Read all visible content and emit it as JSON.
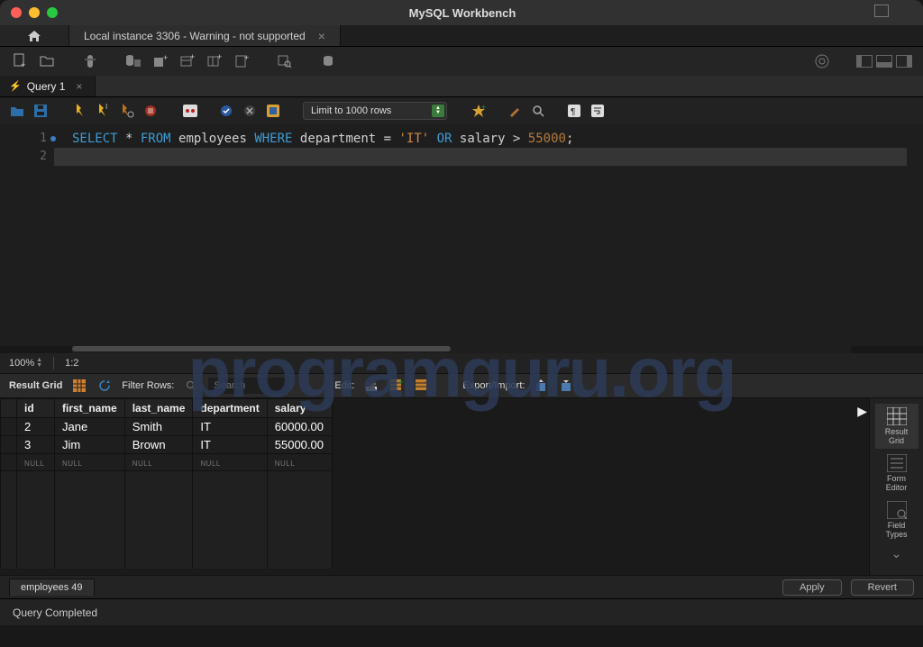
{
  "window": {
    "title": "MySQL Workbench"
  },
  "conn_tab": {
    "label": "Local instance 3306 - Warning - not supported"
  },
  "query_tab": {
    "label": "Query 1"
  },
  "limit_dropdown": {
    "selected": "Limit to 1000 rows"
  },
  "editor": {
    "lines": [
      "1",
      "2"
    ],
    "sql_tokens": [
      {
        "t": "kw",
        "v": "SELECT"
      },
      {
        "t": "op",
        "v": " * "
      },
      {
        "t": "kw",
        "v": "FROM"
      },
      {
        "t": "ident",
        "v": " employees "
      },
      {
        "t": "kw",
        "v": "WHERE"
      },
      {
        "t": "ident",
        "v": " department = "
      },
      {
        "t": "str",
        "v": "'IT'"
      },
      {
        "t": "kw",
        "v": " OR"
      },
      {
        "t": "ident",
        "v": " salary > "
      },
      {
        "t": "num",
        "v": "55000"
      },
      {
        "t": "op",
        "v": ";"
      }
    ]
  },
  "zoom": {
    "pct": "100%",
    "pos": "1:2"
  },
  "result_toolbar": {
    "label": "Result Grid",
    "filter_label": "Filter Rows:",
    "search_placeholder": "Search",
    "edit_label": "Edit:",
    "export_label": "Export/Import:"
  },
  "columns": [
    "id",
    "first_name",
    "last_name",
    "department",
    "salary"
  ],
  "rows": [
    [
      "2",
      "Jane",
      "Smith",
      "IT",
      "60000.00"
    ],
    [
      "3",
      "Jim",
      "Brown",
      "IT",
      "55000.00"
    ]
  ],
  "null_text": "NULL",
  "right_panel": {
    "result_grid": "Result\nGrid",
    "form_editor": "Form\nEditor",
    "field_types": "Field\nTypes"
  },
  "bottom_tab": {
    "label": "employees 49"
  },
  "buttons": {
    "apply": "Apply",
    "revert": "Revert"
  },
  "status": {
    "text": "Query Completed"
  },
  "watermark": "programguru.org"
}
